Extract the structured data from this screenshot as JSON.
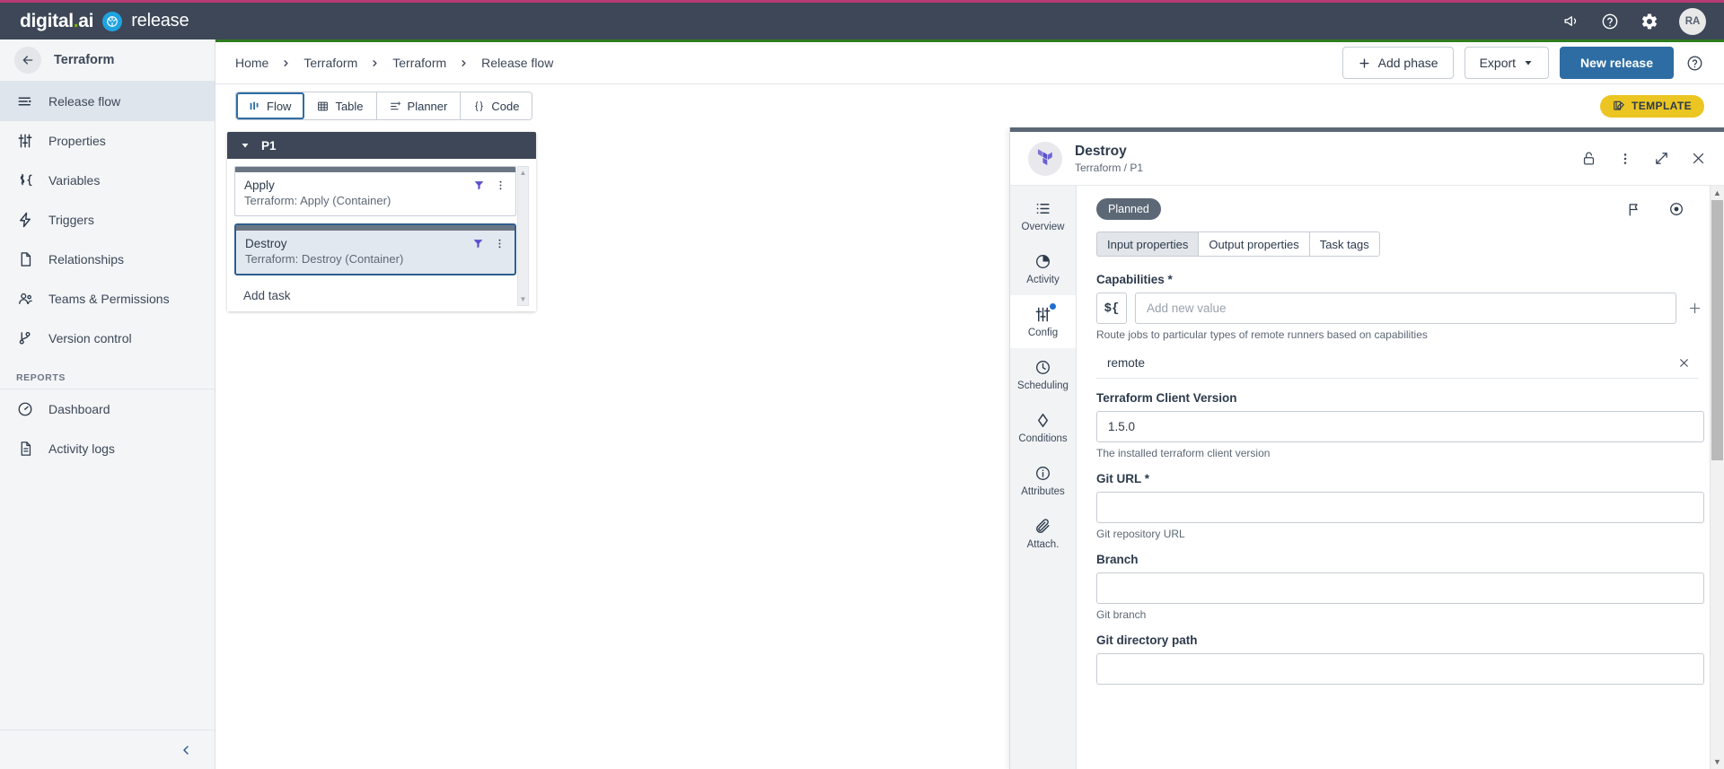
{
  "topbar": {
    "brand_primary": "digital",
    "brand_dot": ".",
    "brand_ai": "ai",
    "brand_product": "release",
    "icons": [
      "announcement-icon",
      "help-icon",
      "settings-icon"
    ],
    "avatar_initials": "RA"
  },
  "sidebar": {
    "header_title": "Terraform",
    "back_label": "←",
    "items": [
      {
        "label": "Release flow",
        "icon": "flow-lines-icon",
        "active": true
      },
      {
        "label": "Properties",
        "icon": "sliders-icon",
        "active": false
      },
      {
        "label": "Variables",
        "icon": "variable-icon",
        "active": false
      },
      {
        "label": "Triggers",
        "icon": "lightning-icon",
        "active": false
      },
      {
        "label": "Relationships",
        "icon": "document-icon",
        "active": false
      },
      {
        "label": "Teams & Permissions",
        "icon": "people-icon",
        "active": false
      },
      {
        "label": "Version control",
        "icon": "branch-icon",
        "active": false
      }
    ],
    "section_label": "REPORTS",
    "report_items": [
      {
        "label": "Dashboard",
        "icon": "gauge-icon"
      },
      {
        "label": "Activity logs",
        "icon": "log-document-icon"
      }
    ],
    "collapse_label": "‹"
  },
  "breadcrumb": {
    "items": [
      "Home",
      "Terraform",
      "Terraform",
      "Release flow"
    ],
    "separator": "›"
  },
  "header_actions": {
    "add_phase": "Add phase",
    "export": "Export",
    "new_release": "New release",
    "help_icon": "help-circle-icon"
  },
  "view_tabs": [
    {
      "label": "Flow",
      "icon": "flow-bars-icon",
      "active": true
    },
    {
      "label": "Table",
      "icon": "grid-icon",
      "active": false
    },
    {
      "label": "Planner",
      "icon": "planner-icon",
      "active": false
    },
    {
      "label": "Code",
      "icon": "braces-icon",
      "active": false
    }
  ],
  "template_badge": {
    "label": "TEMPLATE",
    "icon": "template-icon",
    "color": "#ebc521"
  },
  "flow": {
    "phase": {
      "name": "P1",
      "collapse_icon": "caret-down-icon"
    },
    "tasks": [
      {
        "name": "Apply",
        "subtitle": "Terraform: Apply (Container)",
        "selected": false,
        "icons": [
          "filter-icon",
          "kebab-menu-icon"
        ]
      },
      {
        "name": "Destroy",
        "subtitle": "Terraform: Destroy (Container)",
        "selected": true,
        "icons": [
          "filter-icon",
          "kebab-menu-icon"
        ]
      }
    ],
    "add_task_label": "Add task"
  },
  "panel": {
    "title": "Destroy",
    "subtitle": "Terraform / P1",
    "logo": "terraform-logo-icon",
    "header_icons": [
      "unlock-icon",
      "kebab-menu-icon",
      "expand-icon",
      "close-icon"
    ],
    "vtabs": [
      {
        "label": "Overview",
        "icon": "list-icon",
        "active": false,
        "badge": false
      },
      {
        "label": "Activity",
        "icon": "pie-icon",
        "active": false,
        "badge": false
      },
      {
        "label": "Config",
        "icon": "sliders-icon",
        "active": true,
        "badge": true
      },
      {
        "label": "Scheduling",
        "icon": "clock-icon",
        "active": false,
        "badge": false
      },
      {
        "label": "Conditions",
        "icon": "diamond-icon",
        "active": false,
        "badge": false
      },
      {
        "label": "Attributes",
        "icon": "info-icon",
        "active": false,
        "badge": false
      },
      {
        "label": "Attach.",
        "icon": "paperclip-icon",
        "active": false,
        "badge": false
      }
    ],
    "status_pill": "Planned",
    "status_icons": [
      "flag-icon",
      "eye-target-icon"
    ],
    "prop_tabs": [
      {
        "label": "Input properties",
        "active": true
      },
      {
        "label": "Output properties",
        "active": false
      },
      {
        "label": "Task tags",
        "active": false
      }
    ],
    "fields": {
      "capabilities": {
        "label": "Capabilities *",
        "expr_button": "${",
        "placeholder": "Add new value",
        "value": "",
        "add_icon": "plus-icon",
        "help": "Route jobs to particular types of remote runners based on capabilities",
        "chips": [
          {
            "text": "remote",
            "remove_icon": "close-icon"
          }
        ]
      },
      "terraform_client_version": {
        "label": "Terraform Client Version",
        "value": "1.5.0",
        "help": "The installed terraform client version"
      },
      "git_url": {
        "label": "Git URL *",
        "value": "",
        "help": "Git repository URL"
      },
      "branch": {
        "label": "Branch",
        "value": "",
        "help": "Git branch"
      },
      "git_directory_path": {
        "label": "Git directory path",
        "value": "",
        "help": ""
      }
    }
  }
}
